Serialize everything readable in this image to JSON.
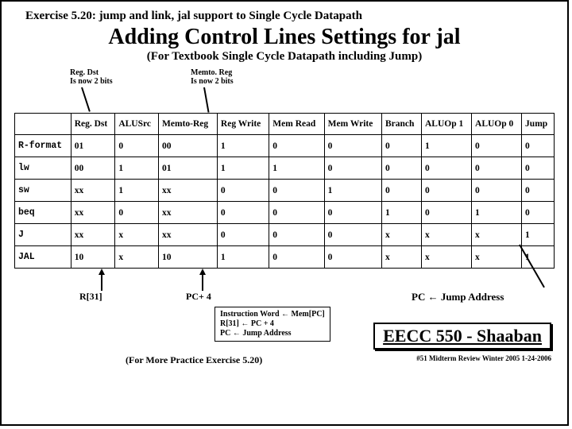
{
  "exercise": "Exercise 5.20:   jump and link, jal support to Single Cycle Datapath",
  "title": "Adding Control Lines Settings for jal",
  "subtitle": "(For Textbook Single Cycle Datapath including Jump)",
  "note1a": "Reg. Dst",
  "note1b": "Is now 2 bits",
  "note2a": "Memto. Reg",
  "note2b": "Is now 2 bits",
  "headers": [
    "",
    "Reg. Dst",
    "ALUSrc",
    "Memto-Reg",
    "Reg Write",
    "Mem Read",
    "Mem Write",
    "Branch",
    "ALUOp 1",
    "ALUOp 0",
    "Jump"
  ],
  "rows": [
    [
      "R-format",
      "01",
      "0",
      "00",
      "1",
      "0",
      "0",
      "0",
      "1",
      "0",
      "0"
    ],
    [
      "lw",
      "00",
      "1",
      "01",
      "1",
      "1",
      "0",
      "0",
      "0",
      "0",
      "0"
    ],
    [
      "sw",
      "xx",
      "1",
      "xx",
      "0",
      "0",
      "1",
      "0",
      "0",
      "0",
      "0"
    ],
    [
      "beq",
      "xx",
      "0",
      "xx",
      "0",
      "0",
      "0",
      "1",
      "0",
      "1",
      "0"
    ],
    [
      "J",
      "xx",
      "x",
      "xx",
      "0",
      "0",
      "0",
      "x",
      "x",
      "x",
      "1"
    ],
    [
      "JAL",
      "10",
      "x",
      "10",
      "1",
      "0",
      "0",
      "x",
      "x",
      "x",
      "1"
    ]
  ],
  "blabel1": "R[31]",
  "blabel2": "PC+ 4",
  "pcj": "PC  ←  Jump Address",
  "ibox": {
    "l1": "Instruction Word  ←   Mem[PC]",
    "l2": "R[31]  ←  PC + 4",
    "l3": "PC  ←  Jump Address"
  },
  "practice": "(For More Practice Exercise 5.20)",
  "course": "EECC 550 - Shaaban",
  "footer": "#51  Midterm Review  Winter 2005  1-24-2006"
}
